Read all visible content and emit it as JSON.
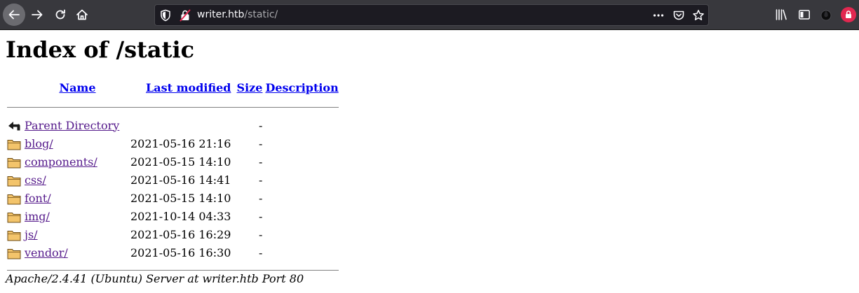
{
  "browser": {
    "url_host": "writer.htb",
    "url_path": "/static/",
    "accent_toolbar": "#38383d",
    "accent_urlbar": "#1c1b22",
    "icons": [
      "back-arrow-icon",
      "forward-arrow-icon",
      "reload-icon",
      "home-icon",
      "shield-icon",
      "insecure-lock-icon",
      "more-icon",
      "pocket-icon",
      "bookmark-star-icon",
      "library-icon",
      "sidebar-icon",
      "extension-icon",
      "blocked-icon"
    ]
  },
  "page": {
    "title": "Index of /static",
    "columns": {
      "name": "Name",
      "last_modified": "Last modified",
      "size": "Size",
      "description": "Description"
    },
    "parent": {
      "name": "Parent Directory",
      "size": "-"
    },
    "rows": [
      {
        "name": "blog/",
        "modified": "2021-05-16 21:16",
        "size": "-"
      },
      {
        "name": "components/",
        "modified": "2021-05-15 14:10",
        "size": "-"
      },
      {
        "name": "css/",
        "modified": "2021-05-16 14:41",
        "size": "-"
      },
      {
        "name": "font/",
        "modified": "2021-05-15 14:10",
        "size": "-"
      },
      {
        "name": "img/",
        "modified": "2021-10-14 04:33",
        "size": "-"
      },
      {
        "name": "js/",
        "modified": "2021-05-16 16:29",
        "size": "-"
      },
      {
        "name": "vendor/",
        "modified": "2021-05-16 16:30",
        "size": "-"
      }
    ],
    "footer": "Apache/2.4.41 (Ubuntu) Server at writer.htb Port 80"
  }
}
